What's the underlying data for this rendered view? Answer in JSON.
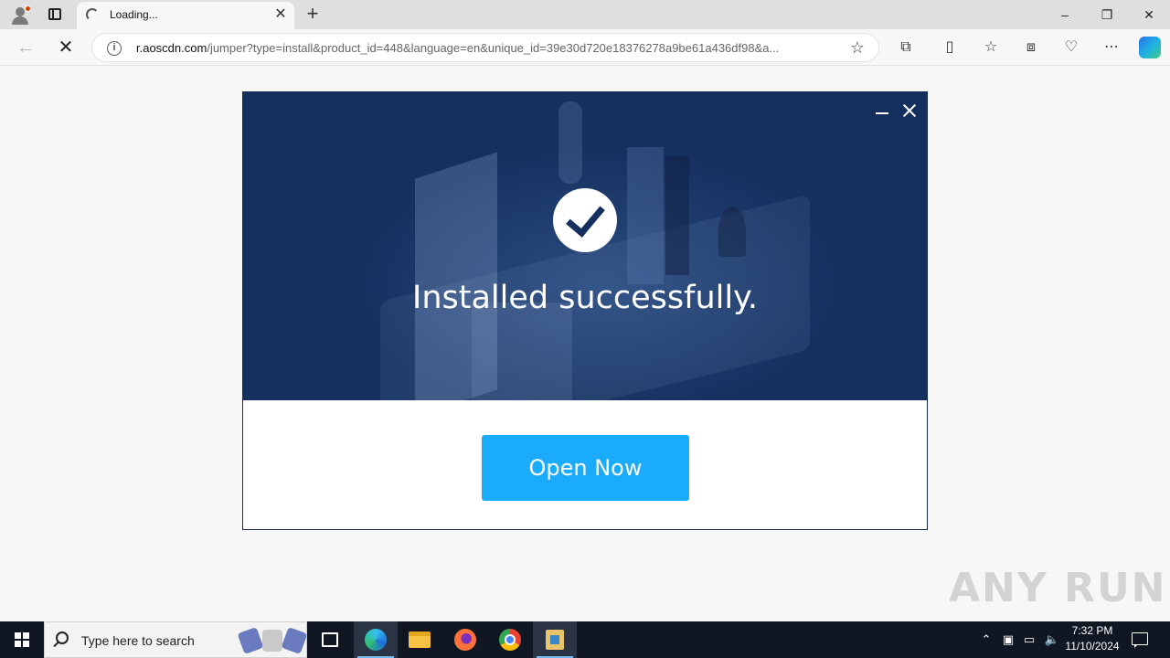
{
  "browser": {
    "tab": {
      "title": "Loading...",
      "close_icon": "close-icon"
    },
    "new_tab_symbol": "+",
    "window_controls": {
      "minimize": "–",
      "restore": "❐",
      "close": "✕"
    },
    "address": {
      "url_host": "r.aoscdn.com",
      "url_rest": "/jumper?type=install&product_id=448&language=en&unique_id=39e30d720e18376278a9be61a436df98&a..."
    },
    "toolbar_icons": [
      "extensions-icon",
      "split-screen-icon",
      "favorites-icon",
      "collections-icon",
      "browser-essentials-icon",
      "more-icon",
      "copilot-icon"
    ]
  },
  "dialog": {
    "message": "Installed successfully.",
    "button_label": "Open Now",
    "colors": {
      "hero_bg": "#15305f",
      "button_bg": "#1aabfb"
    }
  },
  "watermark": {
    "text": "ANY RUN"
  },
  "taskbar": {
    "search_placeholder": "Type here to search",
    "apps": [
      "task-view",
      "microsoft-edge",
      "file-explorer",
      "firefox",
      "google-chrome",
      "installer-app"
    ],
    "clock": {
      "time": "7:32 PM",
      "date": "11/10/2024"
    }
  }
}
